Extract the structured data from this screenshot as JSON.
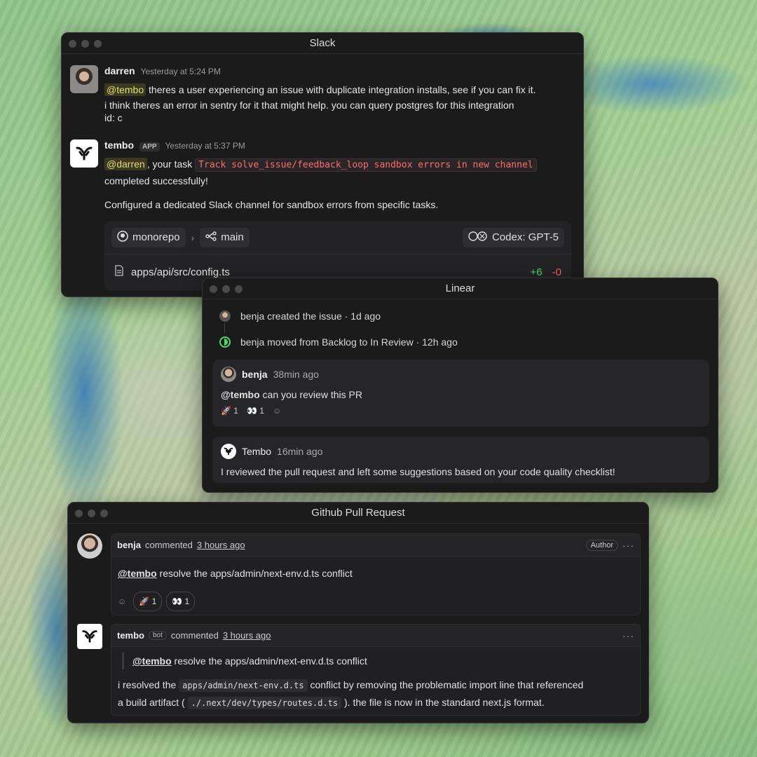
{
  "slack": {
    "title": "Slack",
    "msg1": {
      "user": "darren",
      "time": "Yesterday at 5:24 PM",
      "mention": "@tembo",
      "line1": " theres a user experiencing an issue with duplicate integration installs, see if you can fix it.",
      "line2": "i think theres an error in sentry for it that might help. you can query postgres for this integration",
      "line3": "id: c"
    },
    "msg2": {
      "user": "tembo",
      "tag": "APP",
      "time": "Yesterday at 5:37 PM",
      "mention": "@darren",
      "text_a": ", your task",
      "task_code": "Track solve_issue/feedback_loop sandbox errors in new channel",
      "text_b": "completed successfully!",
      "text_c": "Configured a dedicated Slack channel for sandbox errors from specific tasks."
    },
    "card": {
      "repo": "monorepo",
      "branch": "main",
      "model": "Codex: GPT-5",
      "file": "apps/api/src/config.ts",
      "additions": "+6",
      "deletions": "-0"
    }
  },
  "linear": {
    "title": "Linear",
    "activity": [
      {
        "text": "benja created the issue",
        "time": "1d ago"
      },
      {
        "text": "benja moved from Backlog to In Review",
        "time": "12h ago"
      }
    ],
    "comment1": {
      "user": "benja",
      "time": "38min ago",
      "mention": "@tembo",
      "text": " can you review this PR",
      "rocket_count": "1",
      "eyes_count": "1"
    },
    "comment2": {
      "user": "Tembo",
      "time": "16min ago",
      "text": "I reviewed the pull request and left some suggestions based on your code quality checklist!"
    }
  },
  "github": {
    "title": "Github Pull Request",
    "comment1": {
      "user": "benja",
      "action": "commented",
      "time": "3 hours ago",
      "author_tag": "Author",
      "mention": "@tembo",
      "text": " resolve the apps/admin/next-env.d.ts conflict",
      "rocket_count": "1",
      "eyes_count": "1"
    },
    "comment2": {
      "user": "tembo",
      "tag": "bot",
      "action": "commented",
      "time": "3 hours ago",
      "quote_mention": "@tembo",
      "quote_text": " resolve the apps/admin/next-env.d.ts conflict",
      "p1": "i resolved the ",
      "code1": "apps/admin/next-env.d.ts",
      "p2": " conflict by removing the problematic import line that referenced",
      "p3": "a build artifact ( ",
      "code2": "./.next/dev/types/routes.d.ts",
      "p4": " ). the file is now in the standard next.js format."
    }
  }
}
